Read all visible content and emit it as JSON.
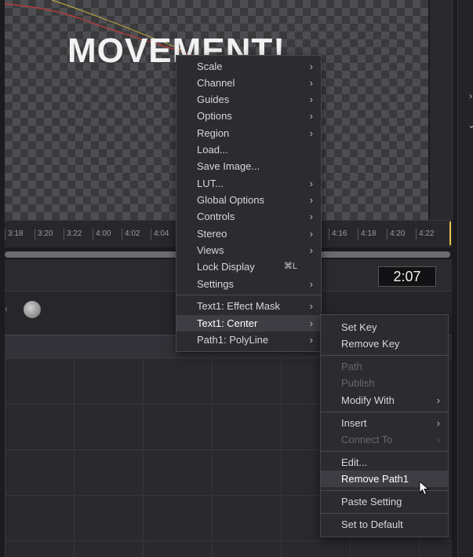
{
  "viewer": {
    "title": "MOVEMENT!"
  },
  "ruler": {
    "ticks": [
      "3:18",
      "3:20",
      "3:22",
      "4:00",
      "4:02",
      "4:04",
      "4:16",
      "4:18",
      "4:20",
      "4:22"
    ]
  },
  "time_display": "2:07",
  "context_menu": {
    "items": [
      {
        "label": "Scale",
        "submenu": true
      },
      {
        "label": "Channel",
        "submenu": true
      },
      {
        "label": "Guides",
        "submenu": true
      },
      {
        "label": "Options",
        "submenu": true
      },
      {
        "label": "Region",
        "submenu": true
      },
      {
        "label": "Load...",
        "submenu": false
      },
      {
        "label": "Save Image...",
        "submenu": false
      },
      {
        "label": "LUT...",
        "submenu": true
      },
      {
        "label": "Global Options",
        "submenu": true
      },
      {
        "label": "Controls",
        "submenu": true
      },
      {
        "label": "Stereo",
        "submenu": true
      },
      {
        "label": "Views",
        "submenu": true
      },
      {
        "label": "Lock Display",
        "shortcut": "⌘L",
        "submenu": false
      },
      {
        "label": "Settings",
        "submenu": true
      }
    ],
    "tool_items": [
      {
        "label": "Text1: Effect Mask",
        "submenu": true
      },
      {
        "label": "Text1: Center",
        "submenu": true,
        "highlighted": true
      },
      {
        "label": "Path1: PolyLine",
        "submenu": true
      }
    ]
  },
  "submenu": {
    "items": [
      {
        "label": "Set Key"
      },
      {
        "label": "Remove Key"
      },
      {
        "label": "Path",
        "disabled": true
      },
      {
        "label": "Publish",
        "disabled": true
      },
      {
        "label": "Modify With",
        "submenu": true
      },
      {
        "label": "Insert",
        "submenu": true
      },
      {
        "label": "Connect To",
        "submenu": true,
        "disabled": true
      },
      {
        "label": "Edit..."
      },
      {
        "label": "Remove Path1",
        "highlighted": true
      },
      {
        "label": "Paste Setting"
      },
      {
        "label": "Set to Default"
      }
    ]
  },
  "icons": {
    "submenu_arrow": "chevron-right-icon",
    "cursor": "mouse-pointer-icon"
  }
}
